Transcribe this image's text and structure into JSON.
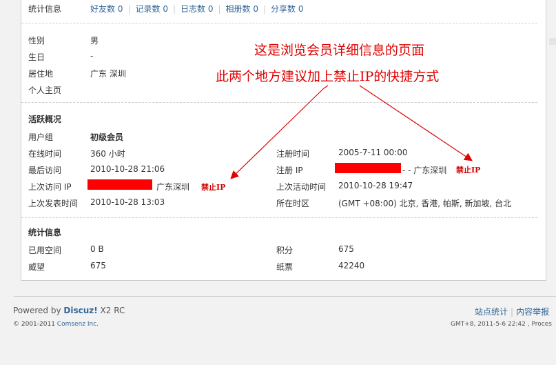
{
  "stats_top": {
    "label": "统计信息",
    "links": [
      {
        "label": "好友数 0"
      },
      {
        "label": "记录数 0"
      },
      {
        "label": "日志数 0"
      },
      {
        "label": "相册数 0"
      },
      {
        "label": "分享数 0"
      }
    ]
  },
  "profile": [
    {
      "label": "性别",
      "value": "男"
    },
    {
      "label": "生日",
      "value": "-"
    },
    {
      "label": "居住地",
      "value": "广东 深圳"
    },
    {
      "label": "个人主页",
      "value": ""
    }
  ],
  "activity": {
    "title": "活跃概况",
    "group_label": "用户组",
    "group_value": "初级会员",
    "online_label": "在线时间",
    "online_value": "360 小时",
    "register_time_label": "注册时间",
    "register_time_value": "2005-7-11 00:00",
    "last_visit_label": "最后访问",
    "last_visit_value": "2010-10-28 21:06",
    "register_ip_label": "注册 IP",
    "register_ip_suffix": "- - 广东深圳",
    "register_ip_ban": "禁止IP",
    "last_ip_label": "上次访问 IP",
    "last_ip_suffix": "广东深圳",
    "last_ip_ban": "禁止IP",
    "last_activity_label": "上次活动时间",
    "last_activity_value": "2010-10-28 19:47",
    "last_post_label": "上次发表时间",
    "last_post_value": "2010-10-28 13:03",
    "timezone_label": "所在时区",
    "timezone_value": "(GMT +08:00) 北京, 香港, 帕斯, 新加坡, 台北"
  },
  "stats": {
    "title": "统计信息",
    "space_label": "已用空间",
    "space_value": "0 B",
    "points_label": "积分",
    "points_value": "675",
    "prestige_label": "威望",
    "prestige_value": "675",
    "paper_label": "纸票",
    "paper_value": "42240"
  },
  "annotation": {
    "line1": "这是浏览会员详细信息的页面",
    "line2": "此两个地方建议加上禁止IP的快捷方式",
    "color": "#e00000"
  },
  "footer": {
    "powered_prefix": "Powered by ",
    "brand": "Discuz!",
    "version": " X2 RC",
    "copyright_prefix": "© 2001-2011 ",
    "company": "Comsenz Inc.",
    "link_stats": "站点统计",
    "link_report": "内容举报",
    "gmt": "GMT+8, 2011-5-6 22:42 , Proces"
  }
}
